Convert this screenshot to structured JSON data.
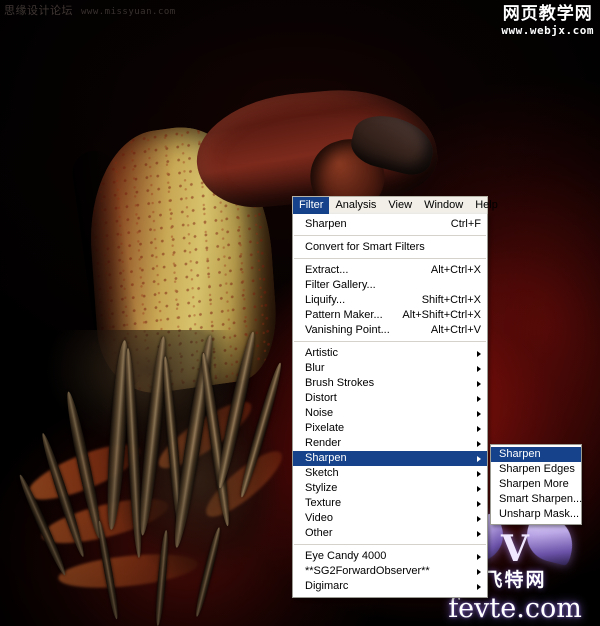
{
  "watermarks": {
    "top_left_text": "思缘设计论坛",
    "top_left_url": "www.missyuan.com",
    "top_right_cn": "网页教学网",
    "top_right_url": "www.webjx.com",
    "bottom_right_cn": "飞特网",
    "bottom_right_url": "fevte.com",
    "bottom_right_mark": "V"
  },
  "photo": {
    "alt": "dark-fantasy-pitcher-plant-over-hand-photo"
  },
  "menubar": {
    "items": [
      {
        "label": "Filter",
        "active": true
      },
      {
        "label": "Analysis",
        "active": false
      },
      {
        "label": "View",
        "active": false
      },
      {
        "label": "Window",
        "active": false
      },
      {
        "label": "Help",
        "active": false
      }
    ]
  },
  "filter_menu": {
    "groups": [
      {
        "items": [
          {
            "label": "Sharpen",
            "accel": "Ctrl+F",
            "submenu": false,
            "selected": false
          }
        ]
      },
      {
        "items": [
          {
            "label": "Convert for Smart Filters",
            "accel": "",
            "submenu": false,
            "selected": false
          }
        ]
      },
      {
        "items": [
          {
            "label": "Extract...",
            "accel": "Alt+Ctrl+X",
            "submenu": false,
            "selected": false
          },
          {
            "label": "Filter Gallery...",
            "accel": "",
            "submenu": false,
            "selected": false
          },
          {
            "label": "Liquify...",
            "accel": "Shift+Ctrl+X",
            "submenu": false,
            "selected": false
          },
          {
            "label": "Pattern Maker...",
            "accel": "Alt+Shift+Ctrl+X",
            "submenu": false,
            "selected": false
          },
          {
            "label": "Vanishing Point...",
            "accel": "Alt+Ctrl+V",
            "submenu": false,
            "selected": false
          }
        ]
      },
      {
        "items": [
          {
            "label": "Artistic",
            "accel": "",
            "submenu": true,
            "selected": false
          },
          {
            "label": "Blur",
            "accel": "",
            "submenu": true,
            "selected": false
          },
          {
            "label": "Brush Strokes",
            "accel": "",
            "submenu": true,
            "selected": false
          },
          {
            "label": "Distort",
            "accel": "",
            "submenu": true,
            "selected": false
          },
          {
            "label": "Noise",
            "accel": "",
            "submenu": true,
            "selected": false
          },
          {
            "label": "Pixelate",
            "accel": "",
            "submenu": true,
            "selected": false
          },
          {
            "label": "Render",
            "accel": "",
            "submenu": true,
            "selected": false
          },
          {
            "label": "Sharpen",
            "accel": "",
            "submenu": true,
            "selected": true
          },
          {
            "label": "Sketch",
            "accel": "",
            "submenu": true,
            "selected": false
          },
          {
            "label": "Stylize",
            "accel": "",
            "submenu": true,
            "selected": false
          },
          {
            "label": "Texture",
            "accel": "",
            "submenu": true,
            "selected": false
          },
          {
            "label": "Video",
            "accel": "",
            "submenu": true,
            "selected": false
          },
          {
            "label": "Other",
            "accel": "",
            "submenu": true,
            "selected": false
          }
        ]
      },
      {
        "items": [
          {
            "label": "Eye Candy 4000",
            "accel": "",
            "submenu": true,
            "selected": false
          },
          {
            "label": "**SG2ForwardObserver**",
            "accel": "",
            "submenu": true,
            "selected": false
          },
          {
            "label": "Digimarc",
            "accel": "",
            "submenu": true,
            "selected": false
          }
        ]
      }
    ]
  },
  "sharpen_submenu": {
    "items": [
      {
        "label": "Sharpen",
        "selected": true
      },
      {
        "label": "Sharpen Edges",
        "selected": false
      },
      {
        "label": "Sharpen More",
        "selected": false
      },
      {
        "label": "Smart Sharpen...",
        "selected": false
      },
      {
        "label": "Unsharp Mask...",
        "selected": false
      }
    ]
  },
  "colors": {
    "menu_highlight": "#15428b",
    "menu_background": "#ffffff",
    "menubar_background": "#f1efe8",
    "menu_text": "#000000"
  }
}
